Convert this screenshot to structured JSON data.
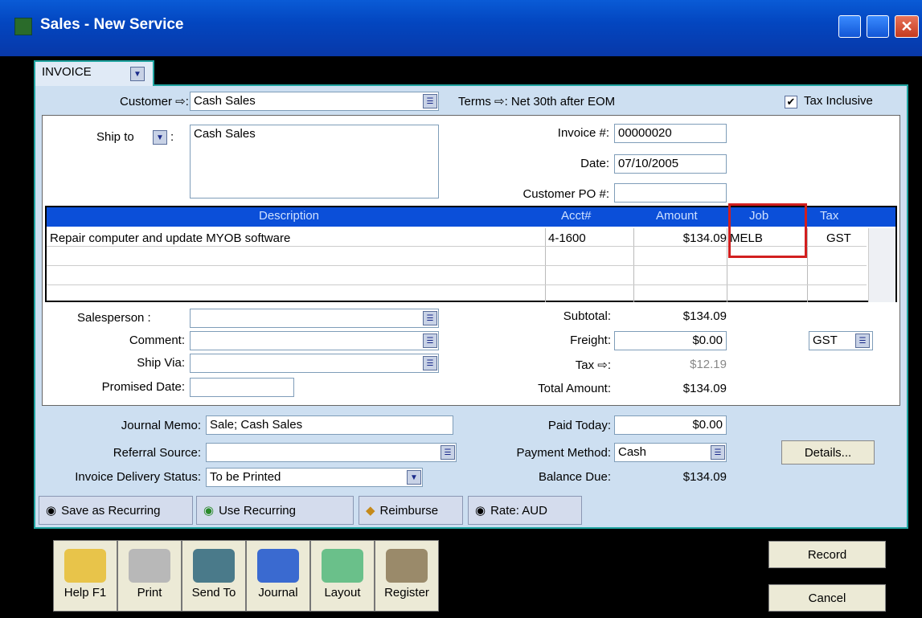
{
  "window": {
    "title": "Sales - New Service"
  },
  "tab": {
    "label": "INVOICE"
  },
  "header": {
    "customer_label": "Customer ⇨:",
    "customer": "Cash Sales",
    "terms": "Terms ⇨: Net 30th after EOM",
    "tax_inclusive_label": "Tax Inclusive",
    "tax_inclusive_mark": "✔"
  },
  "shipping": {
    "ship_to_label": "Ship to",
    "ship_to": "Cash Sales"
  },
  "invoice": {
    "invoice_label": "Invoice #:",
    "invoice_no": "00000020",
    "date_label": "Date:",
    "date": "07/10/2005",
    "po_label": "Customer PO #:",
    "po": ""
  },
  "grid": {
    "headers": [
      "Description",
      "Acct#",
      "Amount",
      "Job",
      "Tax"
    ],
    "rows": [
      {
        "description": "Repair computer and update MYOB software",
        "acct": "4-1600",
        "amount": "$134.09",
        "job": "MELB",
        "tax": "GST"
      }
    ]
  },
  "details": {
    "salesperson_label": "Salesperson :",
    "comment_label": "Comment:",
    "ship_via_label": "Ship Via:",
    "promised_label": "Promised Date:"
  },
  "totals": {
    "subtotal_label": "Subtotal:",
    "subtotal": "$134.09",
    "freight_label": "Freight:",
    "freight": "$0.00",
    "tax_label": "Tax ⇨:",
    "tax": "$12.19",
    "total_label": "Total Amount:",
    "total": "$134.09",
    "freight_tax": "GST"
  },
  "payment": {
    "memo_label": "Journal Memo:",
    "memo": "Sale; Cash Sales",
    "referral_label": "Referral Source:",
    "delivery_label": "Invoice Delivery Status:",
    "delivery": "To be Printed",
    "paid_label": "Paid Today:",
    "paid": "$0.00",
    "method_label": "Payment Method:",
    "method": "Cash",
    "balance_label": "Balance Due:",
    "balance": "$134.09",
    "details_btn": "Details..."
  },
  "actions": {
    "save_recurring": "Save as Recurring",
    "use_recurring": "Use Recurring",
    "reimburse": "Reimburse",
    "rate": "Rate: AUD"
  },
  "toolbar": {
    "help": "Help F1",
    "print": "Print",
    "send": "Send To",
    "journal": "Journal",
    "layout": "Layout",
    "register": "Register",
    "record": "Record",
    "cancel": "Cancel"
  },
  "colors": {
    "title_bar": "#0a5bd6",
    "grid_header": "#0b4fd9",
    "panel": "#cddff1",
    "highlight": "#d21f1f"
  }
}
